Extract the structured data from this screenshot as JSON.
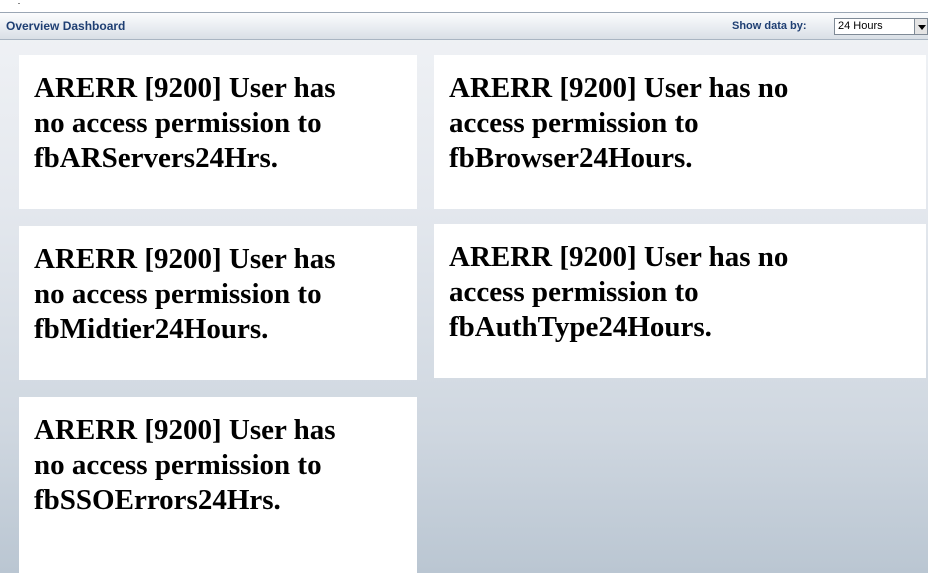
{
  "header": {
    "title": "Overview Dashboard",
    "show_data_label": "Show data by:",
    "period_selected": "24 Hours"
  },
  "panels": [
    {
      "lines": [
        "ARERR [9200] User has",
        "no access permission to",
        "fbARServers24Hrs."
      ]
    },
    {
      "lines": [
        "ARERR [9200] User has no",
        "access permission to",
        "fbBrowser24Hours."
      ]
    },
    {
      "lines": [
        "ARERR [9200] User has",
        "no access permission to",
        "fbMidtier24Hours."
      ]
    },
    {
      "lines": [
        "ARERR [9200] User has no",
        "access permission to",
        "fbAuthType24Hours."
      ]
    },
    {
      "lines": [
        "ARERR [9200] User has",
        "no access permission to",
        "fbSSOErrors24Hrs."
      ]
    }
  ],
  "colors": {
    "header_text": "#1f3f73",
    "panel_bg": "#ffffff"
  },
  "icons": {
    "select_arrow": "chevron-down-icon"
  }
}
